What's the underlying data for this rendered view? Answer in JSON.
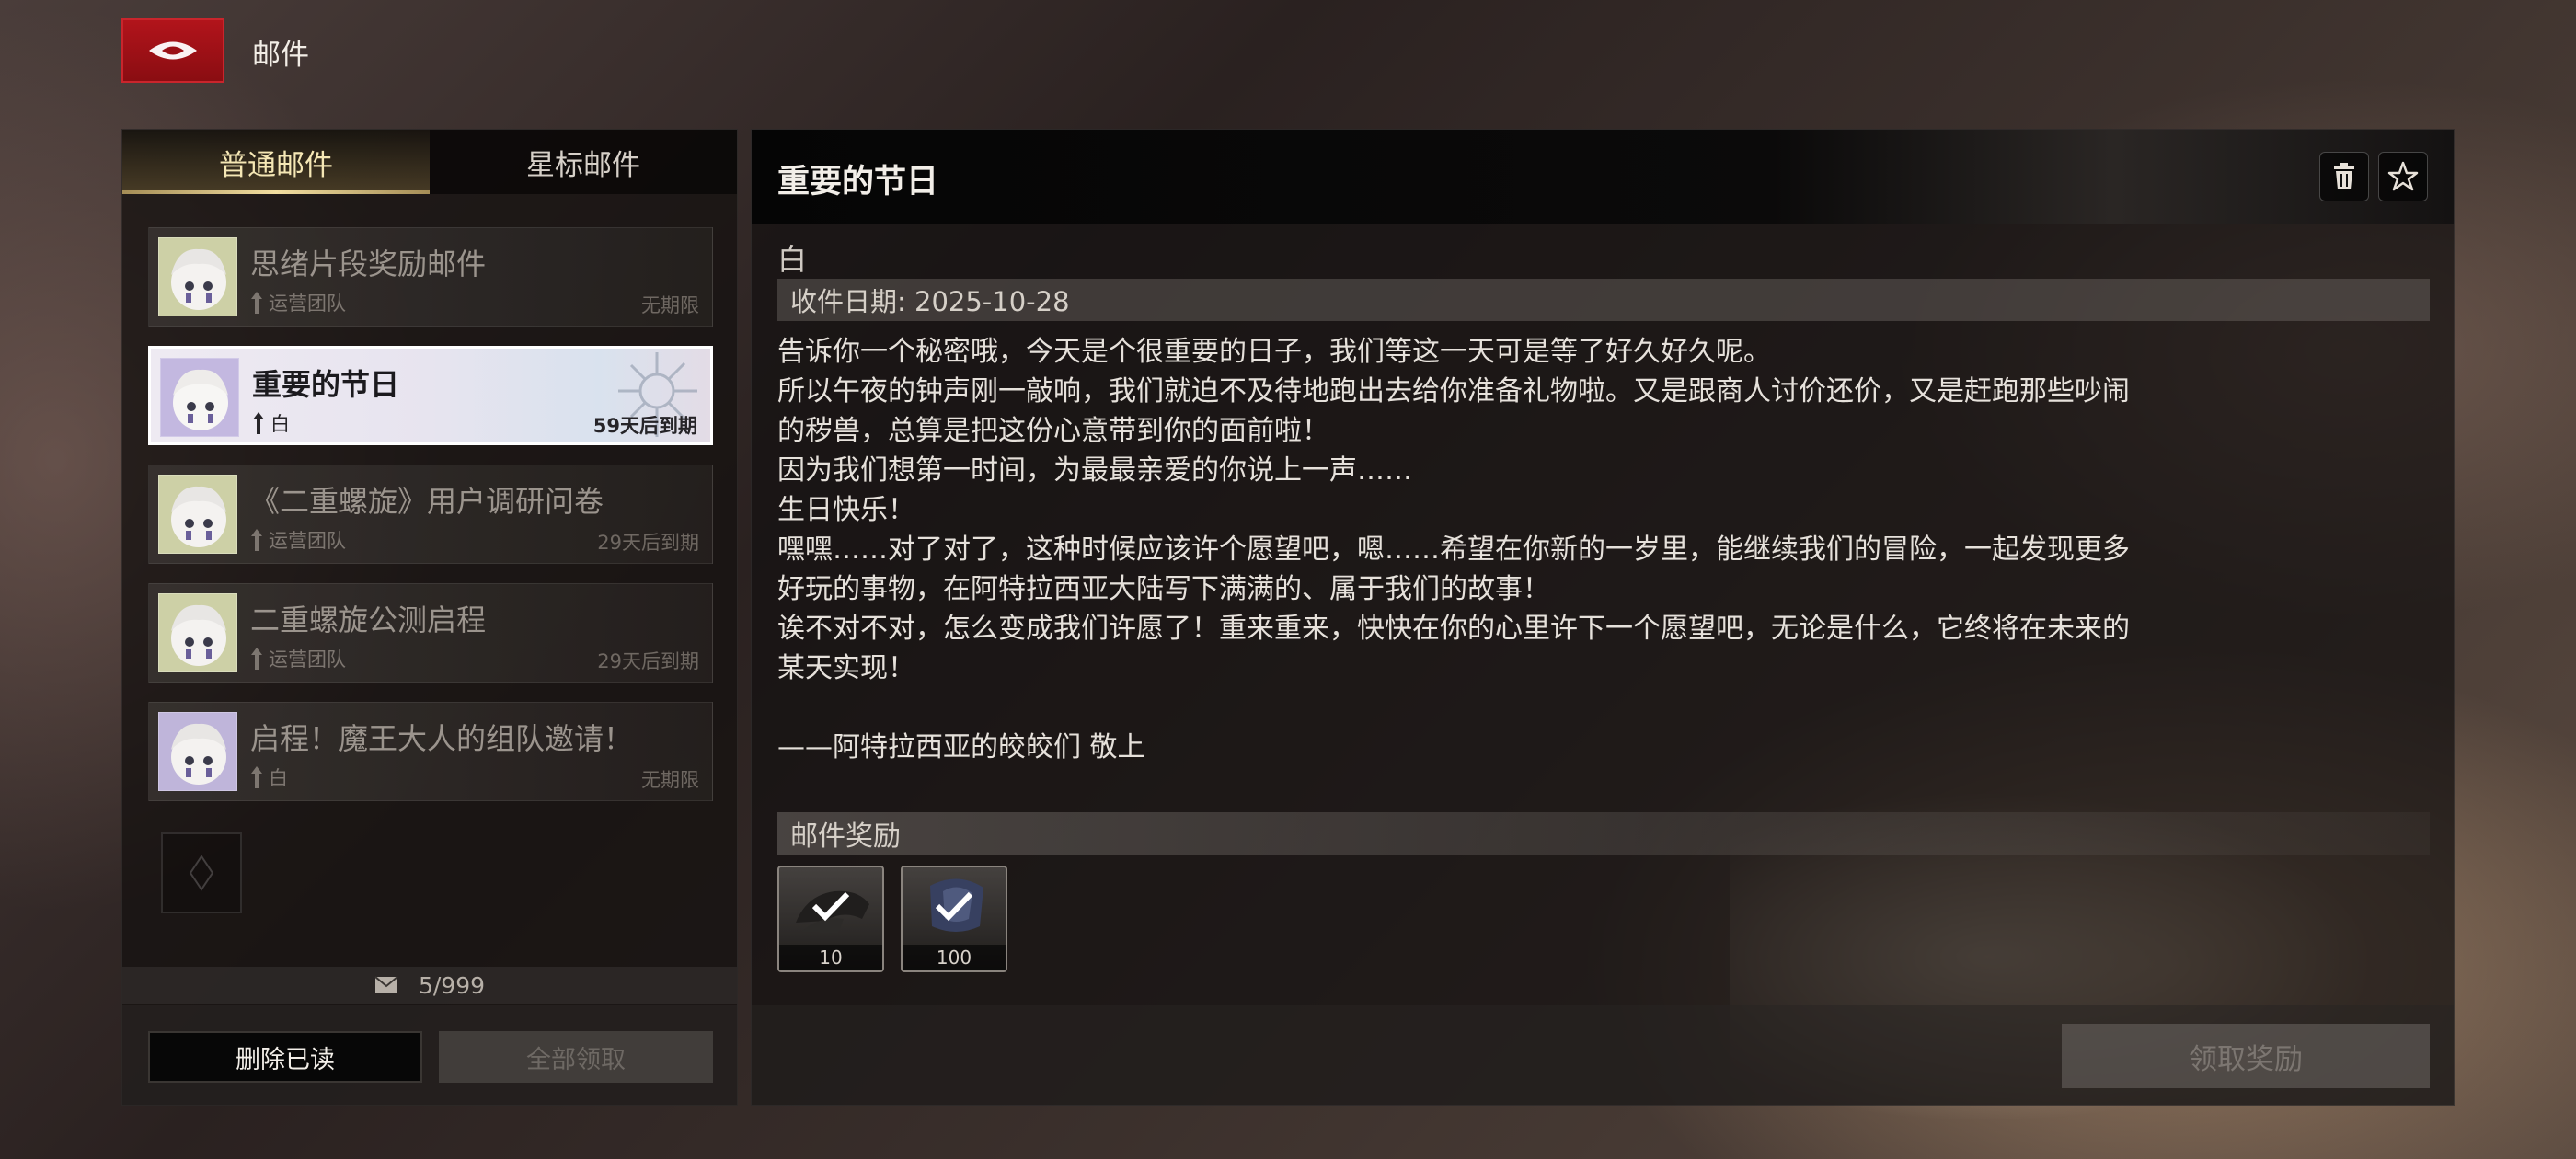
{
  "header": {
    "title": "邮件"
  },
  "tabs": [
    {
      "label": "普通邮件",
      "active": true
    },
    {
      "label": "星标邮件",
      "active": false
    }
  ],
  "mails": [
    {
      "title": "思绪片段奖励邮件",
      "sender": "运营团队",
      "expire": "无期限",
      "active": false
    },
    {
      "title": "重要的节日",
      "sender": "白",
      "expire": "59天后到期",
      "active": true
    },
    {
      "title": "《二重螺旋》用户调研问卷",
      "sender": "运营团队",
      "expire": "29天后到期",
      "active": false
    },
    {
      "title": "二重螺旋公测启程",
      "sender": "运营团队",
      "expire": "29天后到期",
      "active": false
    },
    {
      "title": "启程！魔王大人的组队邀请！",
      "sender": "白",
      "expire": "无期限",
      "active": false
    }
  ],
  "mail_count": "5/999",
  "left_buttons": {
    "delete_read": "删除已读",
    "claim_all": "全部领取"
  },
  "detail": {
    "title": "重要的节日",
    "sender": "白",
    "date": "收件日期: 2025-10-28",
    "body": "告诉你一个秘密哦，今天是个很重要的日子，我们等这一天可是等了好久好久呢。\n所以午夜的钟声刚一敲响，我们就迫不及待地跑出去给你准备礼物啦。又是跟商人讨价还价，又是赶跑那些吵闹\n的秽兽，总算是把这份心意带到你的面前啦！\n因为我们想第一时间，为最最亲爱的你说上一声……\n生日快乐！\n嘿嘿……对了对了，这种时候应该许个愿望吧，嗯……希望在你新的一岁里，能继续我们的冒险，一起发现更多\n好玩的事物，在阿特拉西亚大陆写下满满的、属于我们的故事！\n诶不对不对，怎么变成我们许愿了！重来重来，快快在你的心里许下一个愿望吧，无论是什么，它终将在未来的\n某天实现！\n\n——阿特拉西亚的皎皎们 敬上",
    "reward_label": "邮件奖励",
    "rewards": [
      {
        "qty": "10",
        "claimed": true,
        "icon": "gloves-item-icon"
      },
      {
        "qty": "100",
        "claimed": true,
        "icon": "crystal-item-icon"
      }
    ],
    "claim_button": "领取奖励"
  },
  "colors": {
    "accent_gold": "#f2dea0",
    "logo_red": "#b2141b"
  }
}
